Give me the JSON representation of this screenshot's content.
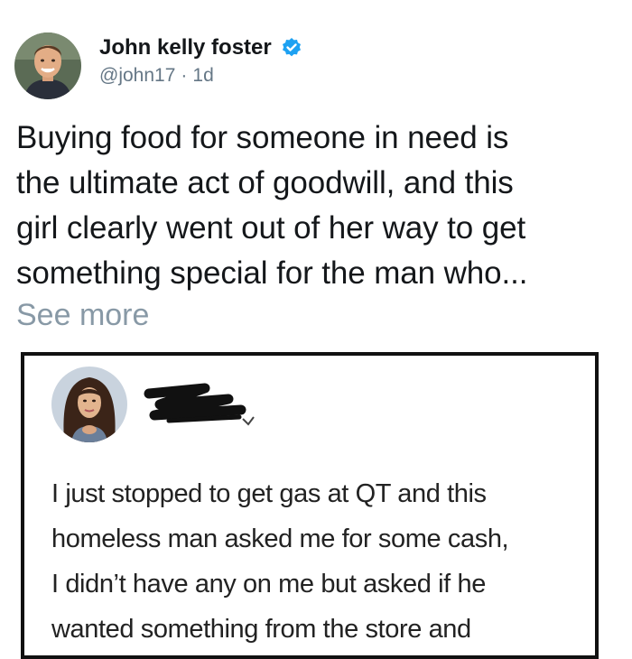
{
  "tweet": {
    "author": {
      "display_name": "John kelly foster",
      "handle": "@john17",
      "separator": "·",
      "time_ago": "1d",
      "verified": true,
      "avatar_icon": "man-portrait-avatar"
    },
    "body_lines": [
      "Buying food for someone in need is",
      "the ultimate act of goodwill, and this",
      "girl clearly went out of her way to get",
      "something special for the man who..."
    ],
    "see_more": "See more",
    "accent_color": "#1da1f2",
    "embedded_image": {
      "avatar_icon": "woman-portrait-avatar",
      "redaction": "redacted-name-scribble",
      "text_lines": [
        "I just stopped to get gas at QT and this",
        "homeless man asked me for some cash,",
        "I didn’t have any on me but asked if he",
        "wanted something from the store and"
      ]
    }
  }
}
